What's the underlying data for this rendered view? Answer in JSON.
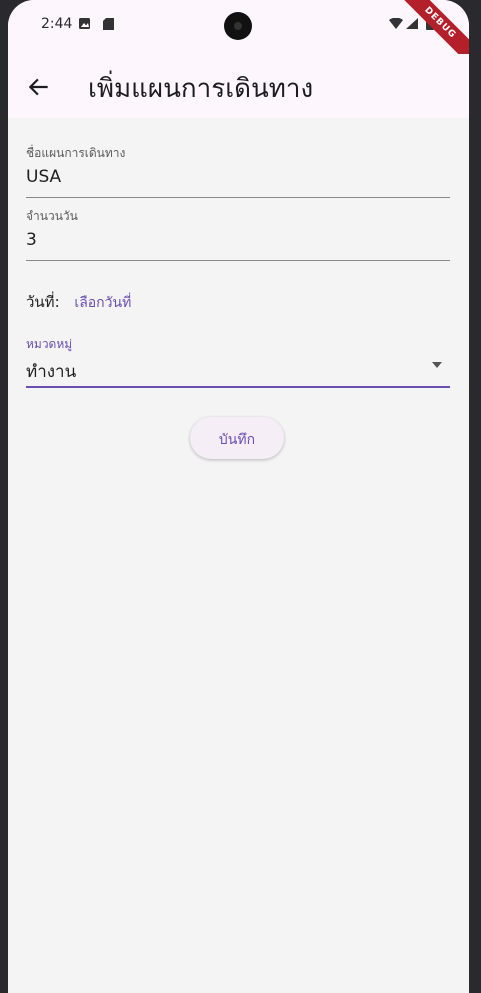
{
  "status_bar": {
    "time": "2:44",
    "debug_label": "DEBUG"
  },
  "app_bar": {
    "title": "เพิ่มแผนการเดินทาง"
  },
  "form": {
    "plan_name": {
      "label": "ชื่อแผนการเดินทาง",
      "value": "USA"
    },
    "days": {
      "label": "จำนวนวัน",
      "value": "3"
    },
    "date": {
      "label": "วันที่:",
      "link": "เลือกวันที่"
    },
    "category": {
      "label": "หมวดหมู่",
      "value": "ทำงาน"
    },
    "save_label": "บันทึก"
  },
  "colors": {
    "accent": "#6a4fb0",
    "appbar": "#fdf6fd",
    "background": "#f4f4f4"
  }
}
